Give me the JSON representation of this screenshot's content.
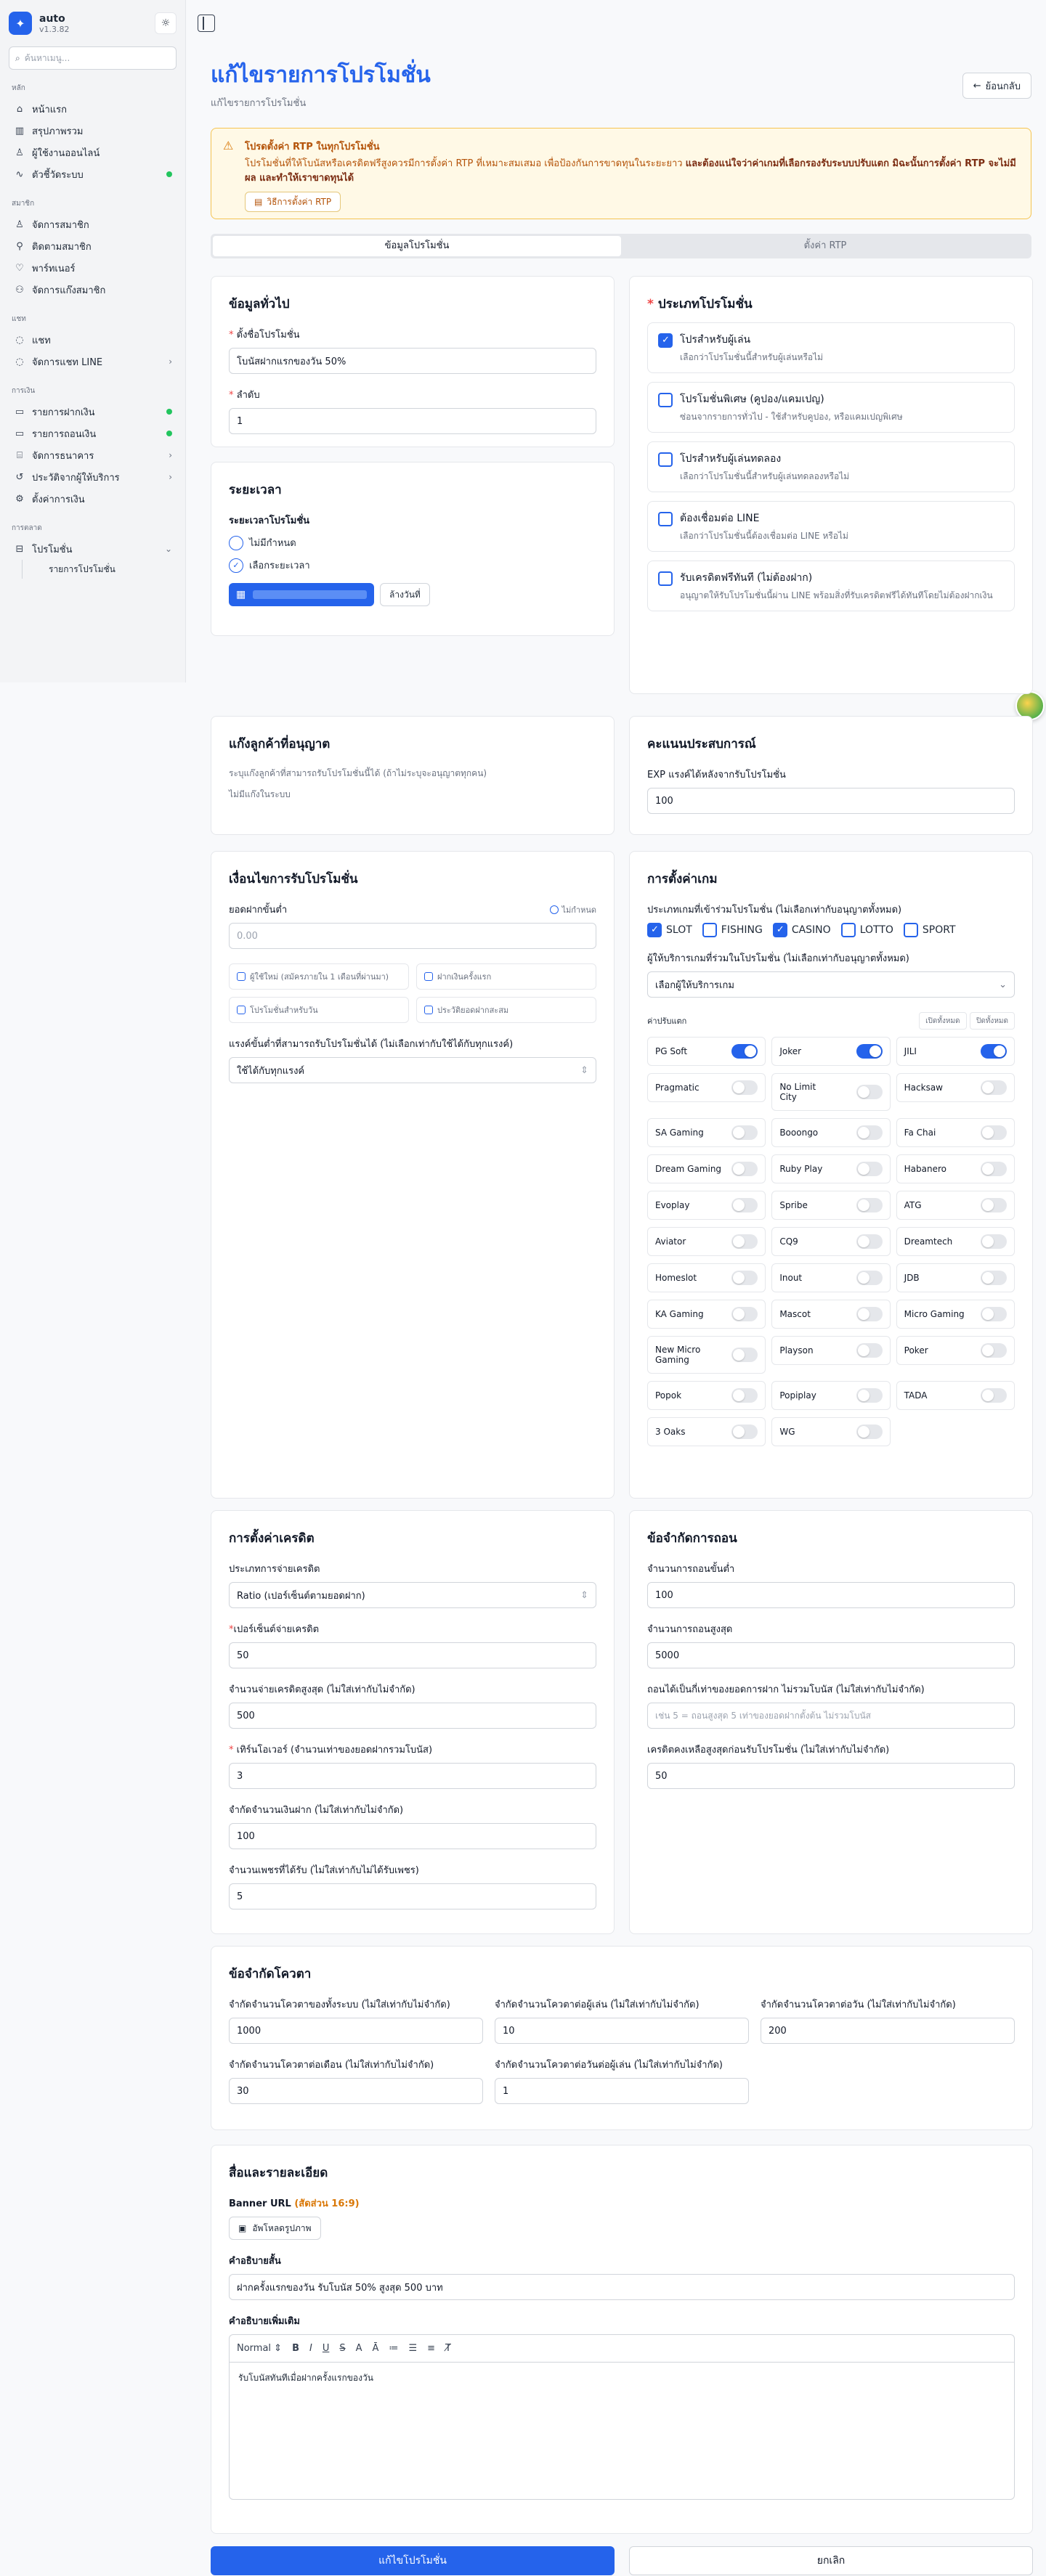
{
  "app": {
    "name": "auto",
    "version": "v1.3.82"
  },
  "sidebar": {
    "search_placeholder": "ค้นหาเมนู...",
    "groups": [
      {
        "title": "หลัก",
        "items": [
          {
            "label": "หน้าแรก",
            "icon": "home-icon"
          },
          {
            "label": "สรุปภาพรวม",
            "icon": "chart-icon"
          },
          {
            "label": "ผู้ใช้งานออนไลน์",
            "icon": "users-icon"
          },
          {
            "label": "ตัวชี้วัดระบบ",
            "icon": "activity-icon",
            "dot": true
          }
        ]
      },
      {
        "title": "สมาชิก",
        "items": [
          {
            "label": "จัดการสมาชิก",
            "icon": "users-icon"
          },
          {
            "label": "ติดตามสมาชิก",
            "icon": "user-search-icon"
          },
          {
            "label": "พาร์ทเนอร์",
            "icon": "handshake-icon"
          },
          {
            "label": "จัดการแก๊งสมาชิก",
            "icon": "group-icon"
          }
        ]
      },
      {
        "title": "แชท",
        "items": [
          {
            "label": "แชท",
            "icon": "chat-icon"
          },
          {
            "label": "จัดการแชท LINE",
            "icon": "chat-icon",
            "chevron": true
          }
        ]
      },
      {
        "title": "การเงิน",
        "items": [
          {
            "label": "รายการฝากเงิน",
            "icon": "wallet-icon",
            "dot": true
          },
          {
            "label": "รายการถอนเงิน",
            "icon": "wallet-icon",
            "dot": true
          },
          {
            "label": "จัดการธนาคาร",
            "icon": "bank-icon",
            "chevron": true
          },
          {
            "label": "ประวัติจากผู้ให้บริการ",
            "icon": "history-icon",
            "chevron": true
          },
          {
            "label": "ตั้งค่าการเงิน",
            "icon": "settings-icon"
          }
        ]
      },
      {
        "title": "การตลาด",
        "items": [
          {
            "label": "โปรโมชั่น",
            "icon": "gift-icon",
            "chevron": true
          }
        ]
      }
    ],
    "sub_item": "รายการโปรโมชั่น"
  },
  "header": {
    "title": "แก้ไขรายการโปรโมชั่น",
    "subtitle": "แก้ไขรายการโปรโมชั่น",
    "back_label": "ย้อนกลับ"
  },
  "alert": {
    "title": "โปรดตั้งค่า RTP ในทุกโปรโมชั่น",
    "text": "โปรโมชั่นที่ให้โบนัสหรือเครดิตฟรีสูงควรมีการตั้งค่า RTP ที่เหมาะสมเสมอ เพื่อป้องกันการขาดทุนในระยะยาว",
    "bold": "และต้องแน่ใจว่าค่าเกมที่เลือกรองรับระบบปรับแตก มิฉะนั้นการตั้งค่า RTP จะไม่มีผล และทำให้เราขาดทุนได้",
    "button": "วิธีการตั้งค่า RTP"
  },
  "tabs": [
    "ข้อมูลโปรโมชั่น",
    "ตั้งค่า RTP"
  ],
  "general": {
    "title": "ข้อมูลทั่วไป",
    "name_label": "ตั้งชื่อโปรโมชั่น",
    "name_value": "โบนัสฝากแรกของวัน 50%",
    "order_label": "ลำดับ",
    "order_value": "1"
  },
  "period": {
    "title": "ระยะเวลา",
    "label": "ระยะเวลาโปรโมชั่น",
    "opt_none": "ไม่มีกำหนด",
    "opt_range": "เลือกระยะเวลา",
    "clear": "ล้างวันที่"
  },
  "promo_type": {
    "title": "ประเภทโปรโมชั่น",
    "options": [
      {
        "title": "โปรสำหรับผู้เล่น",
        "desc": "เลือกว่าโปรโมชั่นนี้สำหรับผู้เล่นหรือไม่",
        "on": true
      },
      {
        "title": "โปรโมชั่นพิเศษ (คูปอง/แคมเปญ)",
        "desc": "ซ่อนจากรายการทั่วไป - ใช้สำหรับคูปอง, หรือแคมเปญพิเศษ",
        "on": false
      },
      {
        "title": "โปรสำหรับผู้เล่นทดลอง",
        "desc": "เลือกว่าโปรโมชั่นนี้สำหรับผู้เล่นทดลองหรือไม่",
        "on": false
      },
      {
        "title": "ต้องเชื่อมต่อ LINE",
        "desc": "เลือกว่าโปรโมชั่นนี้ต้องเชื่อมต่อ LINE หรือไม่",
        "on": false
      },
      {
        "title": "รับเครดิตฟรีทันที (ไม่ต้องฝาก)",
        "desc": "อนุญาตให้รับโปรโมชั่นนี้ผ่าน LINE พร้อมสิ่งที่รับเครดิตฟรีได้ทันทีโดยไม่ต้องฝากเงิน",
        "on": false
      }
    ]
  },
  "gang": {
    "title": "แก๊งลูกค้าที่อนุญาต",
    "desc": "ระบุแก๊งลูกค้าที่สามารถรับโปรโมชั่นนี้ได้ (ถ้าไม่ระบุจะอนุญาตทุกคน)",
    "empty": "ไม่มีแก๊งในระบบ"
  },
  "exp": {
    "title": "คะแนนประสบการณ์",
    "label": "EXP แรงค์ได้หลังจากรับโปรโมชั่น",
    "value": "100"
  },
  "conditions": {
    "title": "เงื่อนไขการรับโปรโมชั่น",
    "min_label": "ยอดฝากขั้นต่ำ",
    "min_toggle": "ไม่กำหนด",
    "min_placeholder": "0.00",
    "checks": [
      "ผู้ใช้ใหม่ (สมัครภายใน 1 เดือนที่ผ่านมา)",
      "ฝากเงินครั้งแรก",
      "โปรโมชั่นสำหรับวัน",
      "ประวัติยอดฝากสะสม"
    ],
    "rank_label": "แรงค์ขั้นต่ำที่สามารถรับโปรโมชั่นได้ (ไม่เลือกเท่ากับใช้ได้กับทุกแรงค์)",
    "rank_value": "ใช้ได้กับทุกแรงค์"
  },
  "games": {
    "title": "การตั้งค่าเกม",
    "types_label": "ประเภทเกมที่เข้าร่วมโปรโมชั่น (ไม่เลือกเท่ากับอนุญาตทั้งหมด)",
    "types": [
      {
        "label": "SLOT",
        "on": true
      },
      {
        "label": "FISHING",
        "on": false
      },
      {
        "label": "CASINO",
        "on": true
      },
      {
        "label": "LOTTO",
        "on": false
      },
      {
        "label": "SPORT",
        "on": false
      }
    ],
    "provider_label": "ผู้ให้บริการเกมที่ร่วมในโปรโมชั่น (ไม่เลือกเท่ากับอนุญาตทั้งหมด)",
    "provider_value": "เลือกผู้ให้บริการเกม",
    "adjust_label": "ค่าปรับแตก",
    "open_all": "เปิดทั้งหมด",
    "close_all": "ปิดทั้งหมด",
    "providers": [
      {
        "name": "PG Soft",
        "on": true
      },
      {
        "name": "Joker",
        "on": true
      },
      {
        "name": "JILI",
        "on": true
      },
      {
        "name": "Pragmatic",
        "on": false
      },
      {
        "name": "No Limit City",
        "on": false
      },
      {
        "name": "Hacksaw",
        "on": false
      },
      {
        "name": "SA Gaming",
        "on": false
      },
      {
        "name": "Booongo",
        "on": false
      },
      {
        "name": "Fa Chai",
        "on": false
      },
      {
        "name": "Dream Gaming",
        "on": false
      },
      {
        "name": "Ruby Play",
        "on": false
      },
      {
        "name": "Habanero",
        "on": false
      },
      {
        "name": "Evoplay",
        "on": false
      },
      {
        "name": "Spribe",
        "on": false
      },
      {
        "name": "ATG",
        "on": false
      },
      {
        "name": "Aviator",
        "on": false
      },
      {
        "name": "CQ9",
        "on": false
      },
      {
        "name": "Dreamtech",
        "on": false
      },
      {
        "name": "Homeslot",
        "on": false
      },
      {
        "name": "Inout",
        "on": false
      },
      {
        "name": "JDB",
        "on": false
      },
      {
        "name": "KA Gaming",
        "on": false
      },
      {
        "name": "Mascot",
        "on": false
      },
      {
        "name": "Micro Gaming",
        "on": false
      },
      {
        "name": "New Micro Gaming",
        "on": false
      },
      {
        "name": "Playson",
        "on": false
      },
      {
        "name": "Poker",
        "on": false
      },
      {
        "name": "Popok",
        "on": false
      },
      {
        "name": "Popiplay",
        "on": false
      },
      {
        "name": "TADA",
        "on": false
      },
      {
        "name": "3 Oaks",
        "on": false
      },
      {
        "name": "WG",
        "on": false
      }
    ]
  },
  "credit": {
    "title": "การตั้งค่าเครดิต",
    "type_label": "ประเภทการจ่ายเครดิต",
    "type_value": "Ratio (เปอร์เซ็นต์ตามยอดฝาก)",
    "percent_label": "เปอร์เซ็นต์จ่ายเครดิต",
    "percent_value": "50",
    "max_label": "จำนวนจ่ายเครดิตสูงสุด (ไม่ใส่เท่ากับไม่จำกัด)",
    "max_value": "500",
    "turnover_label": "เทิร์นโอเวอร์ (จำนวนเท่าของยอดฝากรวมโบนัส)",
    "turnover_value": "3",
    "deposit_limit_label": "จำกัดจำนวนเงินฝาก (ไม่ใส่เท่ากับไม่จำกัด)",
    "deposit_limit_value": "100",
    "diamond_label": "จำนวนเพชรที่ได้รับ (ไม่ใส่เท่ากับไม่ได้รับเพชร)",
    "diamond_value": "5"
  },
  "withdraw": {
    "title": "ข้อจำกัดการถอน",
    "min_label": "จำนวนการถอนขั้นต่ำ",
    "min_value": "100",
    "max_label": "จำนวนการถอนสูงสุด",
    "max_value": "5000",
    "multi_label": "ถอนได้เป็นกี่เท่าของยอดการฝาก ไม่รวมโบนัส (ไม่ใส่เท่ากับไม่จำกัด)",
    "multi_placeholder": "เช่น 5 = ถอนสูงสุด 5 เท่าของยอดฝากตั้งต้น ไม่รวมโบนัส",
    "remain_label": "เครดิตคงเหลือสูงสุดก่อนรับโปรโมชั่น (ไม่ใส่เท่ากับไม่จำกัด)",
    "remain_value": "50"
  },
  "quota": {
    "title": "ข้อจำกัดโควตา",
    "system_label": "จำกัดจำนวนโควตาของทั้งระบบ (ไม่ใส่เท่ากับไม่จำกัด)",
    "system_value": "1000",
    "user_label": "จำกัดจำนวนโควตาต่อผู้เล่น (ไม่ใส่เท่ากับไม่จำกัด)",
    "user_value": "10",
    "day_label": "จำกัดจำนวนโควตาต่อวัน (ไม่ใส่เท่ากับไม่จำกัด)",
    "day_value": "200",
    "month_label": "จำกัดจำนวนโควตาต่อเดือน (ไม่ใส่เท่ากับไม่จำกัด)",
    "month_value": "30",
    "user_day_label": "จำกัดจำนวนโควตาต่อวันต่อผู้เล่น (ไม่ใส่เท่ากับไม่จำกัด)",
    "user_day_value": "1"
  },
  "media": {
    "title": "สื่อและรายละเอียด",
    "banner_label": "Banner URL",
    "banner_ratio": "(สัดส่วน 16:9)",
    "upload": "อัพโหลดรูปภาพ",
    "short_label": "คำอธิบายสั้น",
    "short_value": "ฝากครั้งแรกของวัน รับโบนัส 50% สูงสุด 500 บาท",
    "long_label": "คำอธิบายเพิ่มเติม",
    "format_value": "Normal",
    "editor_text": "รับโบนัสทันทีเมื่อฝากครั้งแรกของวัน"
  },
  "actions": {
    "save": "แก้ไขโปรโมชั่น",
    "cancel": "ยกเลิก"
  },
  "colors": {
    "primary": "#2563eb",
    "warning": "#d97706",
    "success": "#22c55e"
  }
}
